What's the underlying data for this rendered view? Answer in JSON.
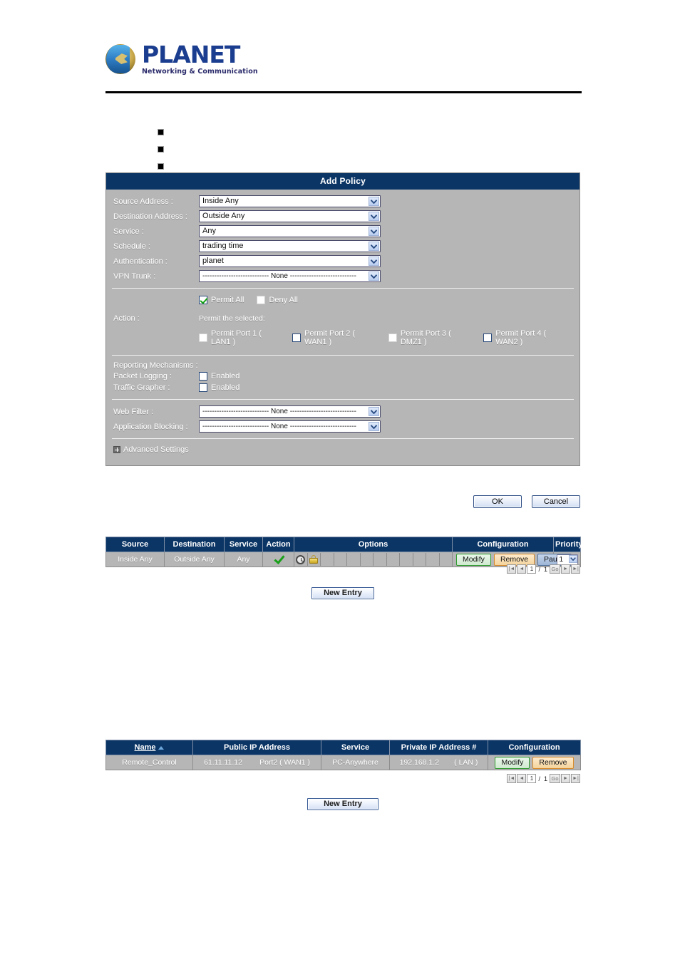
{
  "brand": {
    "name": "PLANET",
    "tagline": "Networking & Communication",
    "logo_icon": "planet-globe-logo"
  },
  "bullets": [
    "",
    "",
    ""
  ],
  "panel": {
    "title": "Add Policy",
    "fields": [
      {
        "label": "Source Address :",
        "value": "Inside Any",
        "name": "source-address"
      },
      {
        "label": "Destination Address :",
        "value": "Outside Any",
        "name": "destination-address"
      },
      {
        "label": "Service :",
        "value": "Any",
        "name": "service"
      },
      {
        "label": "Schedule :",
        "value": "trading time",
        "name": "schedule"
      },
      {
        "label": "Authentication :",
        "value": "planet",
        "name": "authentication"
      },
      {
        "label": "VPN Trunk :",
        "value": "---------------------------- None ----------------------------",
        "name": "vpn-trunk"
      }
    ],
    "action": {
      "label": "Action :",
      "permit_all": "Permit All",
      "permit_all_checked": true,
      "deny_all": "Deny All",
      "deny_all_checked": false,
      "note": "Permit the selected:",
      "ports": [
        {
          "label": "Permit Port  1  ( LAN1 )",
          "checked": false,
          "style": "plain"
        },
        {
          "label": "Permit Port  2  ( WAN1 )",
          "checked": false,
          "style": "blue"
        },
        {
          "label": "Permit Port  3  ( DMZ1 )",
          "checked": false,
          "style": "plain"
        },
        {
          "label": "Permit Port  4  ( WAN2 )",
          "checked": false,
          "style": "blue"
        }
      ]
    },
    "reporting": {
      "heading": "Reporting Mechanisms :",
      "packet_logging_label": "Packet Logging :",
      "packet_logging_value": "Enabled",
      "packet_logging_checked": false,
      "traffic_grapher_label": "Traffic Grapher :",
      "traffic_grapher_value": "Enabled",
      "traffic_grapher_checked": false
    },
    "filters": [
      {
        "label": "Web Filter :",
        "value": "---------------------------- None ----------------------------",
        "name": "web-filter"
      },
      {
        "label": "Application Blocking :",
        "value": "---------------------------- None ----------------------------",
        "name": "application-blocking"
      }
    ],
    "advanced_settings": "Advanced Settings",
    "ok_label": "OK",
    "cancel_label": "Cancel"
  },
  "policy_table": {
    "headers": [
      "Source",
      "Destination",
      "Service",
      "Action",
      "Options",
      "Configuration",
      "Priority"
    ],
    "rows": [
      {
        "source": "Inside Any",
        "destination": "Outside Any",
        "service": "Any",
        "action_icon": "green-check-icon",
        "options_icons": [
          "clock-icon",
          "lock-icon"
        ],
        "options_slots": 10,
        "config": [
          "Modify",
          "Remove",
          "Pause"
        ],
        "priority": "1"
      }
    ],
    "pager": {
      "current": "1",
      "total": "1",
      "go_label": "Go",
      "separator": "/"
    },
    "new_entry_label": "New Entry"
  },
  "virtual_server_table": {
    "headers": [
      "Name",
      "Public IP Address",
      "Service",
      "Private IP Address #",
      "Configuration"
    ],
    "sorted_column": "Name",
    "rows": [
      {
        "name": "Remote_Control",
        "public_ip": "61.11.11.12",
        "public_port": "Port2 ( WAN1 )",
        "service": "PC-Anywhere",
        "private_ip": "192.168.1.2",
        "private_iface": "( LAN )",
        "config": [
          "Modify",
          "Remove"
        ]
      }
    ],
    "pager": {
      "current": "1",
      "total": "1",
      "go_label": "Go",
      "separator": "/"
    },
    "new_entry_label": "New Entry"
  }
}
